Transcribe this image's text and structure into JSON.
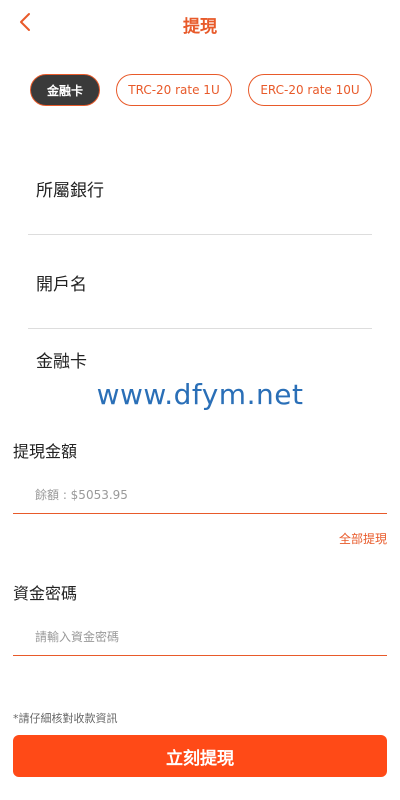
{
  "header": {
    "title": "提現",
    "back_icon": "chevron-left-icon",
    "accent_color": "#e85a2a"
  },
  "methods": [
    {
      "label": "金融卡",
      "active": true
    },
    {
      "label": "TRC-20 rate 1U",
      "active": false
    },
    {
      "label": "ERC-20 rate 10U",
      "active": false
    }
  ],
  "fields": {
    "bank": "所屬銀行",
    "account_name": "開戶名",
    "card": "金融卡"
  },
  "watermark": "www.dfym.net",
  "amount": {
    "label": "提現金額",
    "placeholder": "餘額 : $5053.95",
    "withdraw_all": "全部提現"
  },
  "password": {
    "label": "資金密碼",
    "placeholder": "請輸入資金密碼"
  },
  "notice": "*請仔細核對收款資訊",
  "submit": {
    "label": "立刻提現",
    "color": "#ff4a17"
  }
}
